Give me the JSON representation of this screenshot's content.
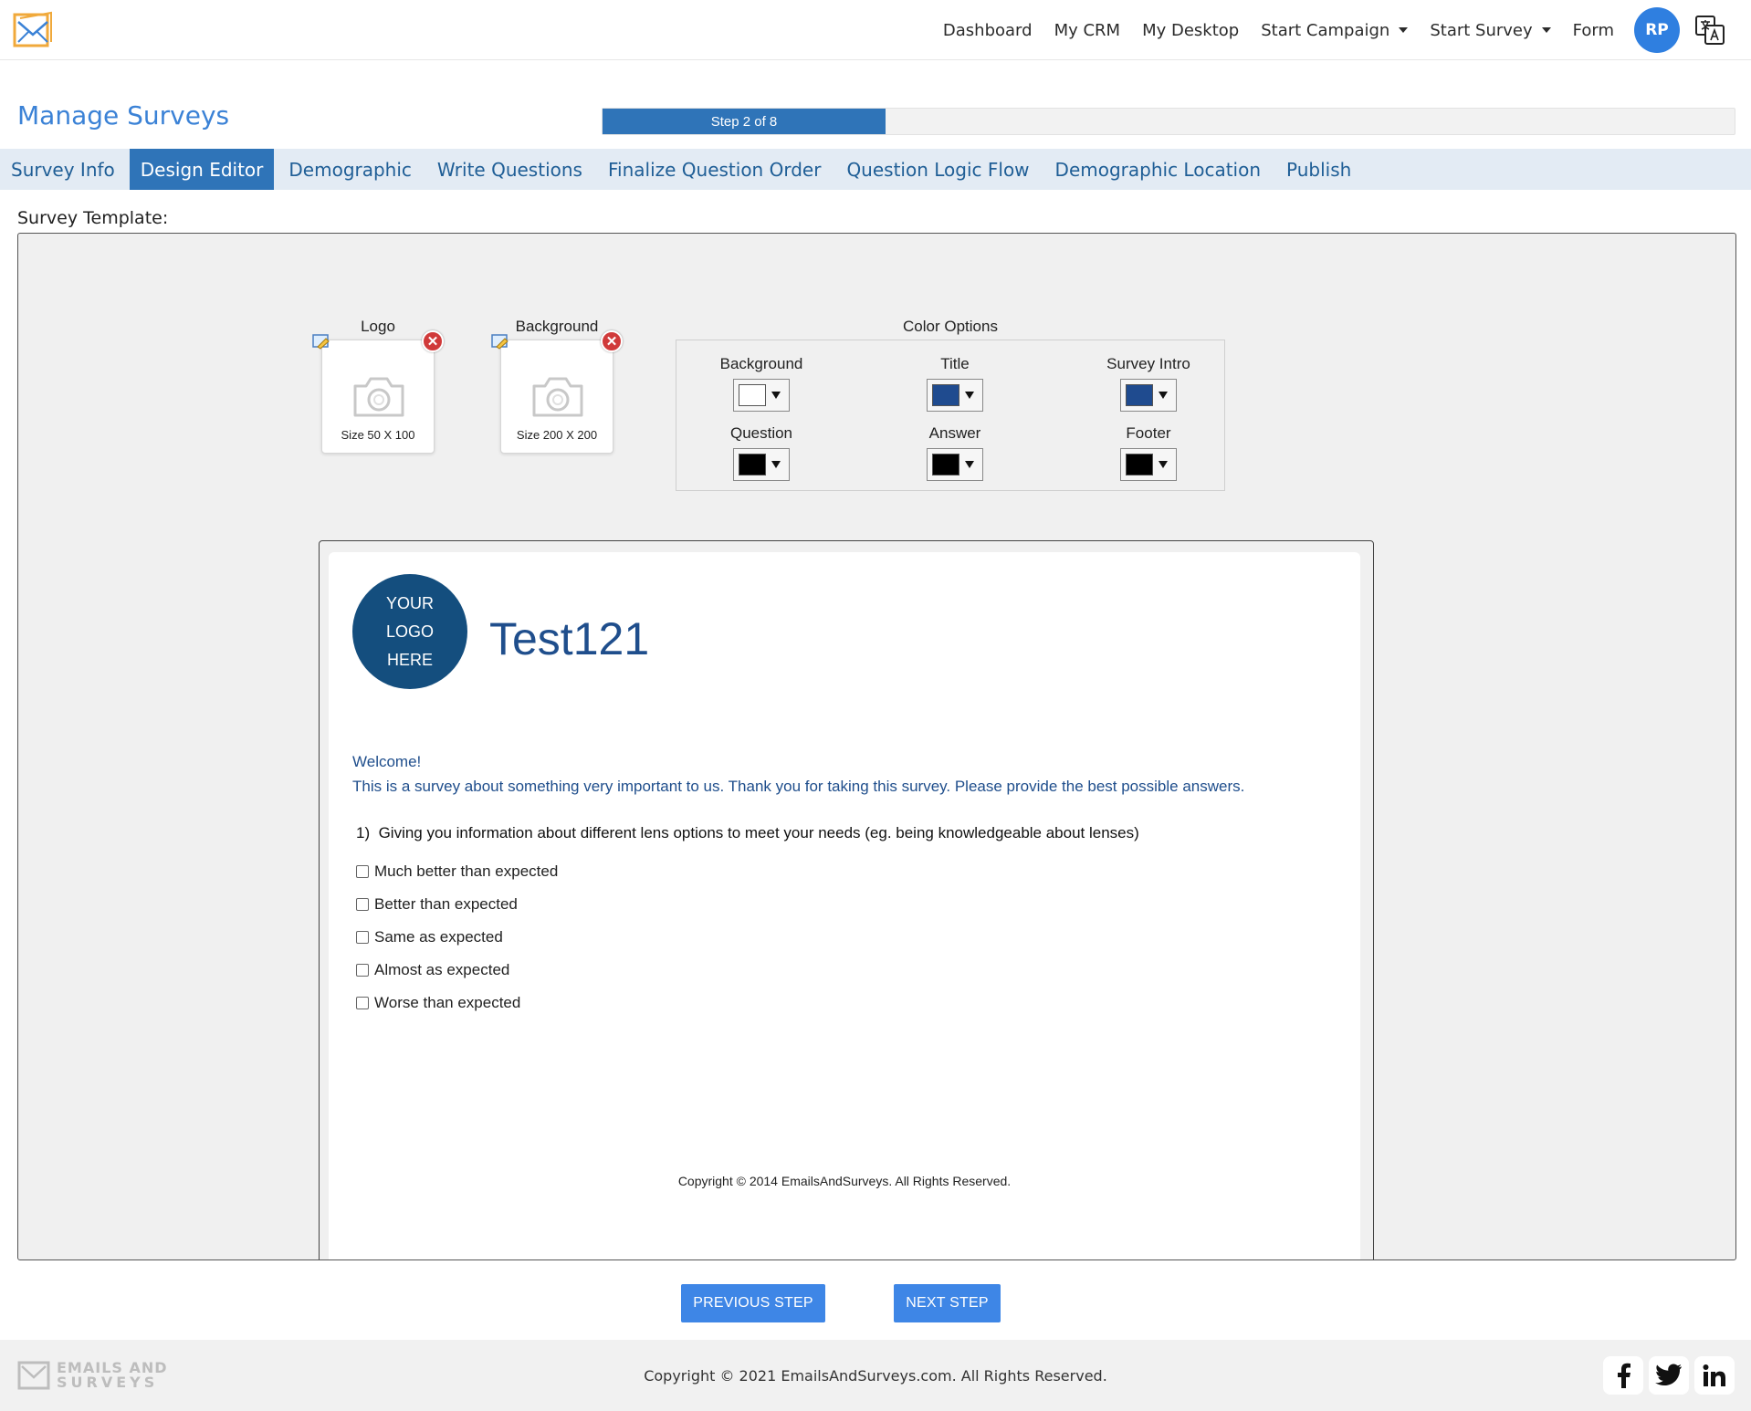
{
  "header": {
    "nav": [
      {
        "label": "Dashboard",
        "dropdown": false
      },
      {
        "label": "My CRM",
        "dropdown": false
      },
      {
        "label": "My Desktop",
        "dropdown": false
      },
      {
        "label": "Start Campaign",
        "dropdown": true
      },
      {
        "label": "Start Survey",
        "dropdown": true
      },
      {
        "label": "Form",
        "dropdown": false
      }
    ],
    "avatar_initials": "RP",
    "logo_icon": "envelope-logo-icon",
    "translate_icon": "translate-icon"
  },
  "page": {
    "title": "Manage Surveys",
    "progress": {
      "label": "Step 2 of 8",
      "current": 2,
      "total": 8
    }
  },
  "tabs": [
    {
      "label": "Survey Info",
      "active": false
    },
    {
      "label": "Design Editor",
      "active": true
    },
    {
      "label": "Demographic",
      "active": false
    },
    {
      "label": "Write Questions",
      "active": false
    },
    {
      "label": "Finalize Question Order",
      "active": false
    },
    {
      "label": "Question Logic Flow",
      "active": false
    },
    {
      "label": "Demographic Location",
      "active": false
    },
    {
      "label": "Publish",
      "active": false
    }
  ],
  "editor": {
    "section_label": "Survey Template:",
    "logo_uploader": {
      "label": "Logo",
      "size": "Size 50 X 100"
    },
    "background_uploader": {
      "label": "Background",
      "size": "Size 200 X 200"
    },
    "color_options": {
      "title": "Color Options",
      "items": [
        {
          "label": "Background",
          "color": "#ffffff"
        },
        {
          "label": "Title",
          "color": "#1f4b8f"
        },
        {
          "label": "Survey Intro",
          "color": "#1f4b8f"
        },
        {
          "label": "Question",
          "color": "#000000"
        },
        {
          "label": "Answer",
          "color": "#000000"
        },
        {
          "label": "Footer",
          "color": "#000000"
        }
      ]
    }
  },
  "preview": {
    "logo_placeholder": [
      "YOUR",
      "LOGO",
      "HERE"
    ],
    "survey_title": "Test121",
    "intro_heading": "Welcome!",
    "intro_text": "This is a survey about something very important to us. Thank you for taking this survey. Please provide the best possible answers.",
    "question_number": "1)",
    "question_text": "Giving you information about different lens options to meet your needs (eg. being knowledgeable about lenses)",
    "answers": [
      "Much better than expected",
      "Better than expected",
      "Same as expected",
      "Almost as expected",
      "Worse than expected"
    ],
    "footer": "Copyright © 2014 EmailsAndSurveys. All Rights Reserved."
  },
  "buttons": {
    "previous": "PREVIOUS STEP",
    "next": "NEXT STEP"
  },
  "footer": {
    "brand_line1": "EMAILS AND",
    "brand_line2": "SURVEYS",
    "copyright": "Copyright © 2021 EmailsAndSurveys.com. All Rights Reserved.",
    "social": [
      {
        "name": "facebook-icon",
        "glyph": "f"
      },
      {
        "name": "twitter-icon",
        "glyph": "t"
      },
      {
        "name": "linkedin-icon",
        "glyph": "in"
      }
    ]
  },
  "colors": {
    "accent": "#2f74b8",
    "title_blue": "#3b82d6",
    "button_blue": "#3e86e6",
    "tab_bar": "#e3ebf4"
  }
}
